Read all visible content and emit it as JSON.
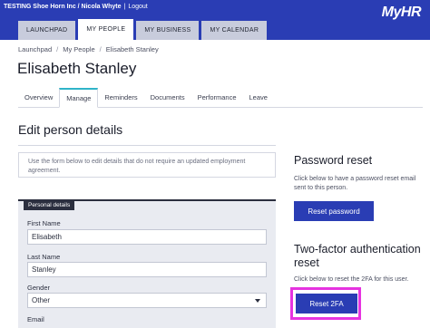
{
  "header": {
    "org_user": "TESTING Shoe Horn Inc / Nicola Whyte",
    "logout": "Logout",
    "logo": "MyHR"
  },
  "nav": {
    "tabs": [
      {
        "label": "LAUNCHPAD",
        "active": false
      },
      {
        "label": "MY PEOPLE",
        "active": true
      },
      {
        "label": "MY BUSINESS",
        "active": false
      },
      {
        "label": "MY CALENDAR",
        "active": false
      }
    ]
  },
  "breadcrumb": [
    "Launchpad",
    "My People",
    "Elisabeth Stanley"
  ],
  "page_title": "Elisabeth Stanley",
  "subtabs": [
    {
      "label": "Overview",
      "active": false
    },
    {
      "label": "Manage",
      "active": true
    },
    {
      "label": "Reminders",
      "active": false
    },
    {
      "label": "Documents",
      "active": false
    },
    {
      "label": "Performance",
      "active": false
    },
    {
      "label": "Leave",
      "active": false
    }
  ],
  "edit": {
    "title": "Edit person details",
    "info": "Use the form below to edit details that do not require an updated employment agreement.",
    "legend": "Personal details",
    "fields": {
      "first_name_label": "First Name",
      "first_name_value": "Elisabeth",
      "last_name_label": "Last Name",
      "last_name_value": "Stanley",
      "gender_label": "Gender",
      "gender_value": "Other",
      "email_label": "Email"
    }
  },
  "password_reset": {
    "title": "Password reset",
    "text": "Click below to have a password reset email sent to this person.",
    "button": "Reset password"
  },
  "two_factor": {
    "title": "Two-factor authentication reset",
    "text": "Click below to reset the 2FA for this user.",
    "button": "Reset 2FA",
    "highlight_color": "#e633e0"
  },
  "colors": {
    "brand": "#2a3db4",
    "active_tab_accent": "#2fb4c8"
  }
}
